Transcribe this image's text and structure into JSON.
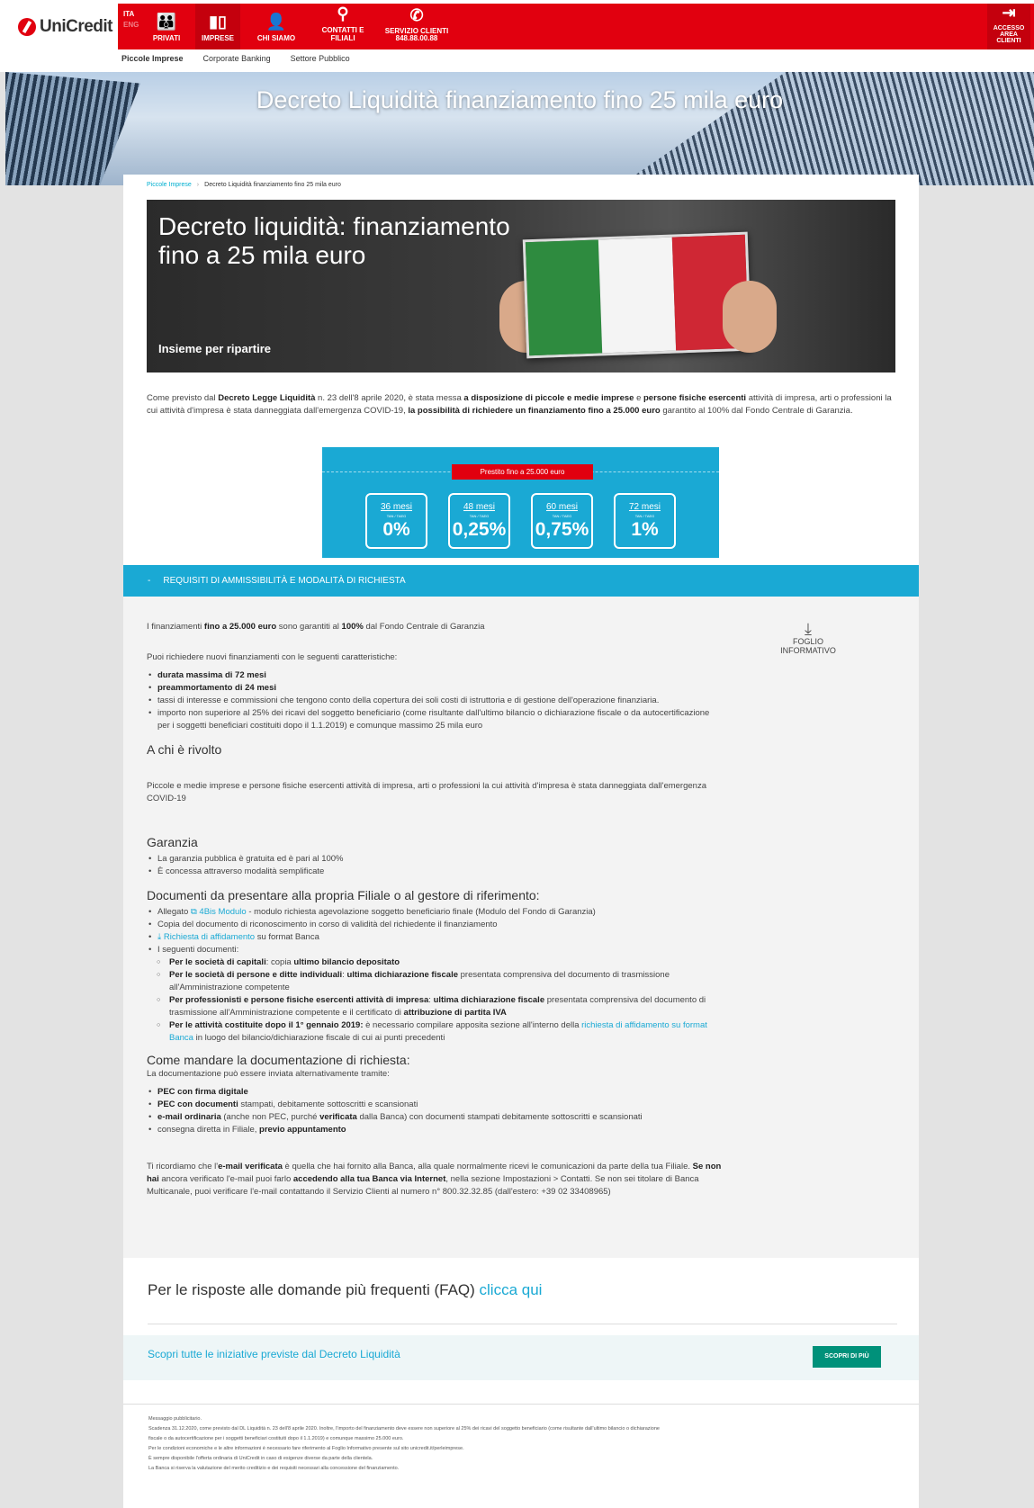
{
  "header": {
    "logo": "UniCredit",
    "lang": {
      "active": "ITA",
      "other": "ENG"
    },
    "nav": [
      {
        "label": "PRIVATI",
        "icon": "family-icon"
      },
      {
        "label": "IMPRESE",
        "icon": "business-icon"
      },
      {
        "label": "CHI SIAMO",
        "icon": "person-icon"
      },
      {
        "label": "CONTATTI E FILIALI",
        "icon": "location-icon"
      },
      {
        "label": "SERVIZIO CLIENTI",
        "sub": "848.88.00.88",
        "icon": "phone-icon"
      }
    ],
    "access": {
      "line1": "ACCESSO",
      "line2": "AREA CLIENTI"
    },
    "subnav": [
      "Piccole Imprese",
      "Corporate Banking",
      "Settore Pubblico"
    ]
  },
  "hero": {
    "title": "Decreto Liquidità finanziamento fino 25 mila euro"
  },
  "breadcrumb": {
    "home": "Piccole Imprese",
    "current": "Decreto Liquidità finanziamento fino 25 mila euro"
  },
  "banner": {
    "line1": "Decreto liquidità: finanziamento",
    "line2": "fino a 25 mila euro",
    "tagline": "Insieme per ripartire"
  },
  "intro": {
    "t1": "Come previsto dal ",
    "b1": "Decreto Legge Liquidità",
    "t2": " n. 23 dell'8 aprile 2020, è stata messa ",
    "b2": "a disposizione di piccole e medie imprese",
    "t3": " e ",
    "b3": "persone fisiche esercenti",
    "t4": " attività di impresa, arti o professioni la cui attività d'impresa è stata danneggiata dall'emergenza COVID-19, ",
    "b4": "la possibilità di richiedere un finanziamento fino a 25.000 euro",
    "t5": " garantito al 100% dal Fondo Centrale di Garanzia."
  },
  "rates": {
    "pill": "Prestito fino a 25.000 euro",
    "items": [
      {
        "months": "36 mesi",
        "sub": "TAN / TAEG",
        "value": "0%"
      },
      {
        "months": "48 mesi",
        "sub": "TAN / TAEG",
        "value": "0,25%"
      },
      {
        "months": "60 mesi",
        "sub": "TAN / TAEG",
        "value": "0,75%"
      },
      {
        "months": "72 mesi",
        "sub": "TAN / TAEG",
        "value": "1%"
      }
    ]
  },
  "accordion": {
    "minus": "-",
    "title": "REQUISITI DI AMMISSIBILITÀ E MODALITÀ DI RICHIESTA"
  },
  "requirements": {
    "p1a": "I finanziamenti ",
    "p1b": "fino a 25.000 euro",
    "p1c": " sono garantiti al ",
    "p1d": "100%",
    "p1e": " dal Fondo Centrale di Garanzia",
    "p2": "Puoi richiedere nuovi finanziamenti con le seguenti caratteristiche:",
    "b1": "durata massima di 72 mesi",
    "b2": "preammortamento di 24 mesi",
    "b3": "tassi di interesse e commissioni che tengono conto della copertura dei soli costi di istruttoria e di gestione dell'operazione finanziaria.",
    "b4": "importo non superiore al 25% dei ricavi del soggetto beneficiario (come risultante dall'ultimo bilancio o dichiarazione fiscale o da autocertificazione per i soggetti beneficiari costituiti  dopo il 1.1.2019) e comunque massimo 25 mila euro"
  },
  "foglio": {
    "label": "FOGLIO INFORMATIVO"
  },
  "rivolto": {
    "title": "A chi è rivolto",
    "text": "Piccole e medie imprese e persone fisiche esercenti attività di impresa, arti o professioni la cui attività d'impresa è stata danneggiata dall'emergenza COVID-19"
  },
  "garanzia": {
    "title": "Garanzia",
    "b1": "La garanzia pubblica è gratuita ed è pari al 100%",
    "b2": "È concessa attraverso modalità semplificate"
  },
  "documenti": {
    "title": "Documenti da presentare alla propria Filiale o al gestore di riferimento:",
    "l1a": "Allegato ",
    "l1link": "4Bis Modulo",
    "l1b": " - modulo richiesta agevolazione soggetto beneficiario finale (Modulo del Fondo di Garanzia)",
    "l2": "Copia del documento di riconoscimento in corso di validità del richiedente il finanziamento",
    "l3link": "Richiesta di affidamento",
    "l3b": " su format Banca",
    "l4": "I seguenti documenti:",
    "s1a": "Per le società di capitali",
    "s1b": ": copia ",
    "s1c": "ultimo bilancio depositato",
    "s2a": "Per le società di persone e ditte individuali",
    "s2b": ": ",
    "s2c": "ultima dichiarazione fiscale",
    "s2d": " presentata comprensiva del documento di trasmissione all'Amministrazione competente",
    "s3a": "Per professionisti e persone fisiche esercenti attività di impresa",
    "s3b": ": ",
    "s3c": "ultima dichiarazione fiscale",
    "s3d": " presentata comprensiva del documento di trasmissione all'Amministrazione competente e il certificato di ",
    "s3e": "attribuzione di partita IVA",
    "s4a": "Per le attività costituite dopo il 1° gennaio 2019:",
    "s4b": " è necessario compilare apposita sezione all'interno  della ",
    "s4link": "richiesta di affidamento su format Banca",
    "s4c": " in luogo del bilancio/dichiarazione fiscale di cui ai punti precedenti"
  },
  "mandare": {
    "title": "Come mandare la documentazione di richiesta:",
    "p": "La documentazione può essere inviata alternativamente tramite:",
    "b1": "PEC con firma digitale",
    "b2a": "PEC con documenti",
    "b2b": " stampati, debitamente sottoscritti e scansionati",
    "b3a": "e-mail ordinaria",
    "b3b": " (anche non PEC, purché ",
    "b3c": "verificata",
    "b3d": " dalla Banca) con documenti stampati debitamente sottoscritti e scansionati",
    "b4a": "consegna diretta in Filiale, ",
    "b4b": "previo appuntamento",
    "n1": "Ti ricordiamo che l'",
    "n2": "e-mail verificata",
    "n3": " è quella che hai fornito alla Banca, alla quale normalmente ricevi le comunicazioni da parte della tua Filiale. ",
    "n4": "Se non hai",
    "n5": " ancora verificato l'e-mail puoi farlo ",
    "n6": "accedendo alla tua Banca via Internet",
    "n7": ", nella sezione Impostazioni > Contatti. Se non sei titolare di Banca Multicanale, puoi verificare l'e-mail contattando il Servizio Clienti al numero n° 800.32.32.85 (dall'estero: +39 02 33408965)"
  },
  "faq": {
    "text": "Per le risposte alle domande più frequenti (FAQ) ",
    "link": "clicca qui"
  },
  "discover": {
    "text": "Scopri tutte le iniziative previste dal Decreto Liquidità",
    "button": "SCOPRI DI PIÙ"
  },
  "legal": [
    "Messaggio pubblicitario.",
    "Scadenza 31.12.2020, come previsto dal DL Liquidità n. 23 dell'8 aprile 2020. Inoltre, l'importo del finanziamento deve essere non superiore al 25% dei ricavi del soggetto beneficiario (come risultante dall'ultimo bilancio o dichiarazione",
    "fiscale o da autocertificazione per i soggetti beneficiari costituiti dopo il 1.1.2019) e comunque massimo 25.000 euro.",
    "Per le condizioni economiche e le altre informazioni è necessario fare riferimento al Foglio Informativo presente sul sito unicredit.it/perleimprese.",
    "È sempre disponibile l'offerta ordinaria di UniCredit in caso di esigenze diverse da parte della clientela.",
    "La Banca si riserva la valutazione del merito creditizio e dei requisiti necessari alla concessione del finanziamento."
  ]
}
